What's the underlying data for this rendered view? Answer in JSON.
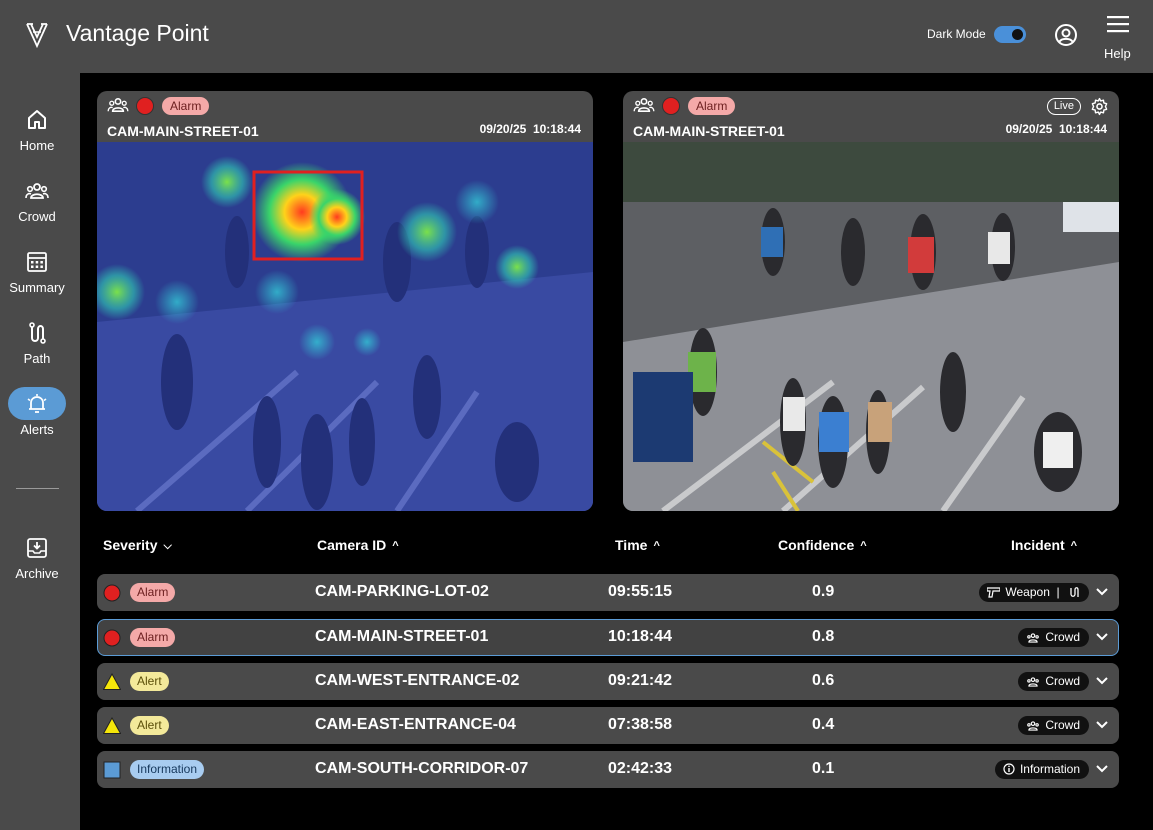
{
  "app": {
    "title": "Vantage Point"
  },
  "header": {
    "dark_mode_label": "Dark Mode",
    "dark_mode_on": true,
    "help_label": "Help"
  },
  "sidebar": {
    "items": [
      {
        "label": "Home",
        "icon": "home-icon"
      },
      {
        "label": "Crowd",
        "icon": "crowd-icon"
      },
      {
        "label": "Summary",
        "icon": "summary-icon"
      },
      {
        "label": "Path",
        "icon": "path-icon"
      },
      {
        "label": "Alerts",
        "icon": "bell-icon",
        "active": true
      },
      {
        "label": "Archive",
        "icon": "archive-icon"
      }
    ]
  },
  "cameras": [
    {
      "status": "Alarm",
      "name": "CAM-MAIN-STREET-01",
      "timestamp": "09/20/25  10:18:44",
      "view": "heatmap"
    },
    {
      "status": "Alarm",
      "name": "CAM-MAIN-STREET-01",
      "timestamp": "09/20/25  10:18:44",
      "live": "Live",
      "view": "live"
    }
  ],
  "table": {
    "headers": {
      "severity": "Severity",
      "camera_id": "Camera ID",
      "time": "Time",
      "confidence": "Confidence",
      "incident": "Incident"
    },
    "rows": [
      {
        "severity": "Alarm",
        "camera_id": "CAM-PARKING-LOT-02",
        "time": "09:55:15",
        "confidence": "0.9",
        "incident": "Weapon  |",
        "incident_icon": "weapon-icon"
      },
      {
        "severity": "Alarm",
        "camera_id": "CAM-MAIN-STREET-01",
        "time": "10:18:44",
        "confidence": "0.8",
        "incident": "Crowd",
        "incident_icon": "crowd-icon",
        "selected": true
      },
      {
        "severity": "Alert",
        "camera_id": "CAM-WEST-ENTRANCE-02",
        "time": "09:21:42",
        "confidence": "0.6",
        "incident": "Crowd",
        "incident_icon": "crowd-icon"
      },
      {
        "severity": "Alert",
        "camera_id": "CAM-EAST-ENTRANCE-04",
        "time": "07:38:58",
        "confidence": "0.4",
        "incident": "Crowd",
        "incident_icon": "crowd-icon"
      },
      {
        "severity": "Information",
        "camera_id": "CAM-SOUTH-CORRIDOR-07",
        "time": "02:42:33",
        "confidence": "0.1",
        "incident": "Information",
        "incident_icon": "info-icon"
      }
    ]
  },
  "colors": {
    "alarm": "#e02020",
    "alert": "#f5e60a",
    "info": "#5b9bd5",
    "accent": "#5b9bd5"
  }
}
